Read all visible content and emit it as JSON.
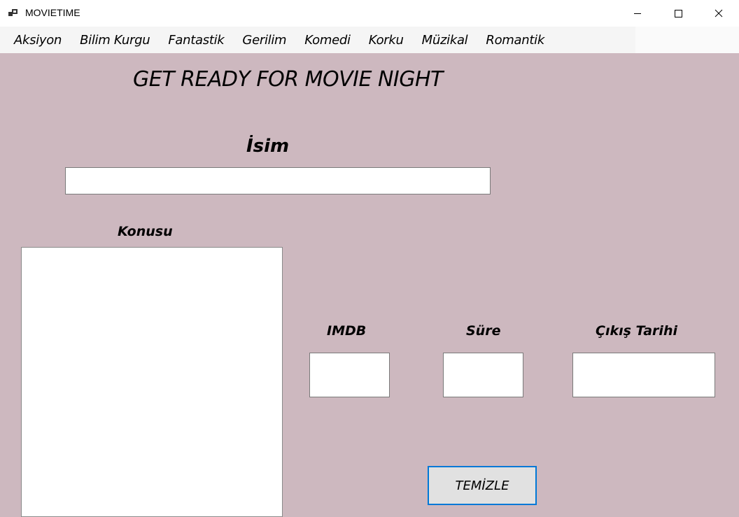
{
  "window": {
    "title": "MOVIETIME",
    "app_icon": "app-window-icon",
    "controls": {
      "minimize_icon": "minimize-icon",
      "maximize_icon": "maximize-icon",
      "close_icon": "close-icon"
    }
  },
  "menu": {
    "items": [
      {
        "label": "Aksiyon"
      },
      {
        "label": "Bilim Kurgu"
      },
      {
        "label": "Fantastik"
      },
      {
        "label": "Gerilim"
      },
      {
        "label": "Komedi"
      },
      {
        "label": "Korku"
      },
      {
        "label": "Müzikal"
      },
      {
        "label": "Romantik"
      }
    ]
  },
  "main": {
    "heading": "GET READY FOR MOVIE NIGHT",
    "name_label": "İsim",
    "name_value": "",
    "plot_label": "Konusu",
    "plot_value": "",
    "imdb_label": "IMDB",
    "imdb_value": "",
    "duration_label": "Süre",
    "duration_value": "",
    "release_label": "Çıkış Tarihi",
    "release_value": "",
    "clear_button": "TEMİZLE"
  },
  "colors": {
    "background": "#cdb8bf",
    "menubar": "#f5f5f5",
    "button_focus_border": "#0078d7"
  }
}
